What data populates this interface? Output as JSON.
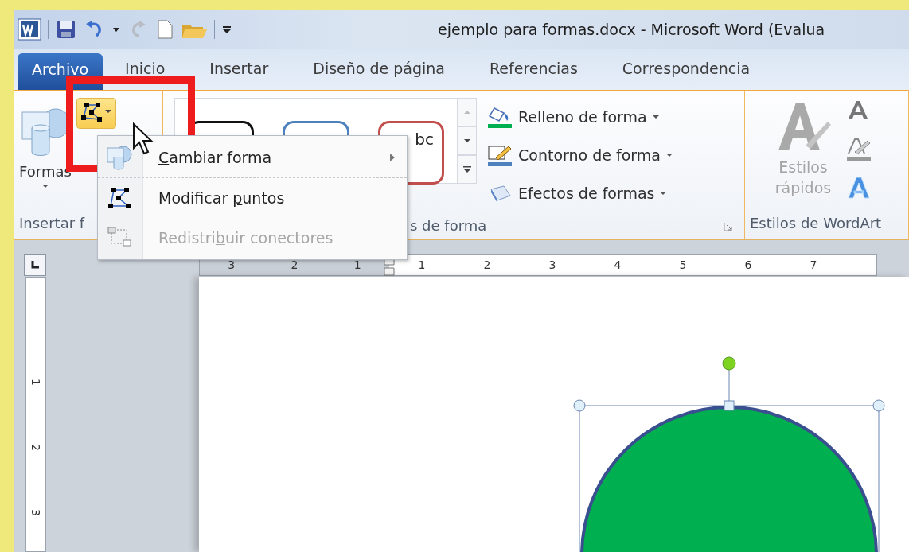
{
  "window": {
    "title": "ejemplo para formas.docx  -  Microsoft Word (Evalua"
  },
  "tabs": [
    {
      "label": "Archivo",
      "kind": "file",
      "selected": false
    },
    {
      "label": "Inicio",
      "kind": "tab",
      "selected": false
    },
    {
      "label": "Insertar",
      "kind": "tab",
      "selected": false
    },
    {
      "label": "Diseño de página",
      "kind": "tab",
      "selected": false
    },
    {
      "label": "Referencias",
      "kind": "tab",
      "selected": false
    },
    {
      "label": "Correspondencia",
      "kind": "tab",
      "selected": false
    }
  ],
  "ribbon": {
    "formas_button": {
      "label": "Formas"
    },
    "gallery": [
      {
        "color": "#111111"
      },
      {
        "color": "#4f81bd"
      },
      {
        "color": "#c0504d",
        "text": "bc"
      }
    ],
    "shape_commands": [
      {
        "label": "Relleno de forma",
        "kind": "fill"
      },
      {
        "label": "Contorno de forma",
        "kind": "outline"
      },
      {
        "label": "Efectos de formas",
        "kind": "effects"
      }
    ],
    "quick_styles": {
      "lines": [
        "Estilos",
        "rápidos"
      ],
      "disabled": true
    },
    "groups": [
      {
        "label": "Insertar f"
      },
      {
        "label": "s de forma"
      },
      {
        "label": "Estilos de WordArt"
      }
    ]
  },
  "menu": {
    "items": [
      {
        "key": "C",
        "post": "ambiar forma",
        "kind": "submenu",
        "disabled": false
      },
      {
        "pre": "Modificar ",
        "key": "p",
        "post": "untos",
        "kind": "edit",
        "disabled": false
      },
      {
        "pre": "Redistri",
        "key": "b",
        "post": "uir conectores",
        "kind": "reroute",
        "disabled": true
      }
    ]
  },
  "ruler": {
    "left_labels": [
      "3",
      "2",
      "1"
    ],
    "right_labels": [
      "1",
      "2",
      "3",
      "4",
      "5",
      "6",
      "7"
    ]
  },
  "vertical_ruler": {
    "labels": [
      "1",
      "2",
      "3"
    ]
  }
}
